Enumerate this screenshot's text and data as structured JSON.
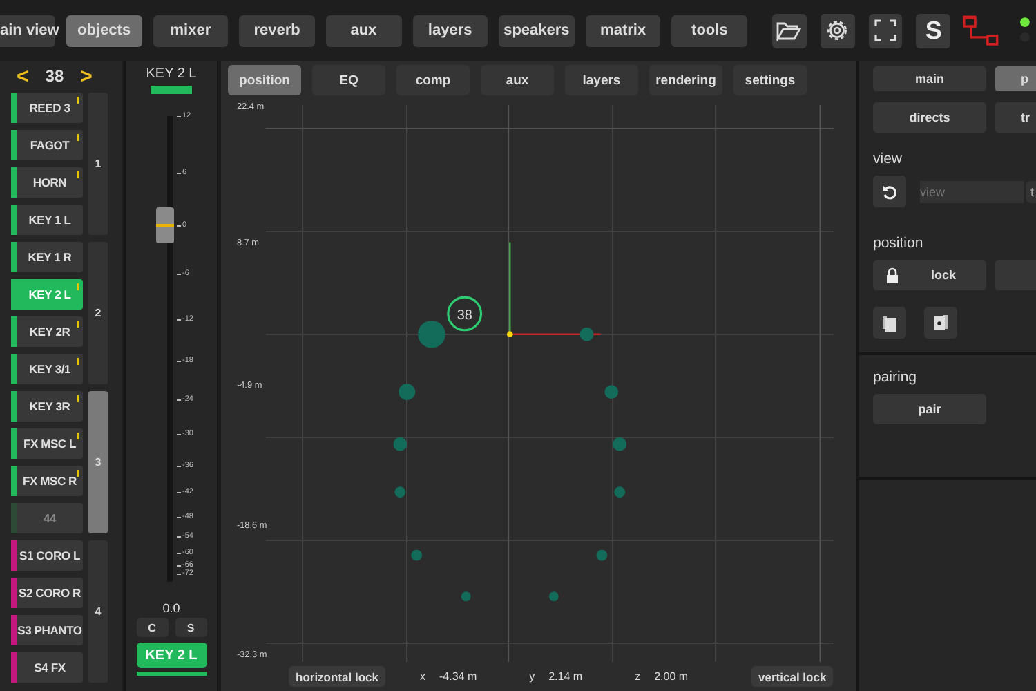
{
  "nav": {
    "items": [
      {
        "label": "ain view",
        "selected": false
      },
      {
        "label": "objects",
        "selected": true
      },
      {
        "label": "mixer",
        "selected": false
      },
      {
        "label": "reverb",
        "selected": false
      },
      {
        "label": "aux",
        "selected": false
      },
      {
        "label": "layers",
        "selected": false
      },
      {
        "label": "speakers",
        "selected": false
      },
      {
        "label": "matrix",
        "selected": false
      },
      {
        "label": "tools",
        "selected": false
      }
    ],
    "s_button": "S"
  },
  "objects": {
    "prev": "<",
    "current": "38",
    "next": ">",
    "groups": [
      {
        "label": "1",
        "selected": false,
        "items": [
          {
            "name": "REED 3",
            "color": "#22b95c",
            "selected": false,
            "enabled": true,
            "flag": true
          },
          {
            "name": "FAGOT",
            "color": "#22b95c",
            "selected": false,
            "enabled": true,
            "flag": true
          },
          {
            "name": "HORN",
            "color": "#22b95c",
            "selected": false,
            "enabled": true,
            "flag": true
          },
          {
            "name": "KEY 1 L",
            "color": "#22b95c",
            "selected": false,
            "enabled": true,
            "flag": false
          }
        ]
      },
      {
        "label": "2",
        "selected": false,
        "items": [
          {
            "name": "KEY 1 R",
            "color": "#22b95c",
            "selected": false,
            "enabled": true,
            "flag": false
          },
          {
            "name": "KEY 2 L",
            "color": "#22b95c",
            "selected": true,
            "enabled": true,
            "flag": true
          },
          {
            "name": "KEY 2R",
            "color": "#22b95c",
            "selected": false,
            "enabled": true,
            "flag": true
          },
          {
            "name": "KEY 3/1",
            "color": "#22b95c",
            "selected": false,
            "enabled": true,
            "flag": true
          }
        ]
      },
      {
        "label": "3",
        "selected": true,
        "items": [
          {
            "name": "KEY 3R",
            "color": "#22b95c",
            "selected": false,
            "enabled": true,
            "flag": true
          },
          {
            "name": "FX MSC L",
            "color": "#22b95c",
            "selected": false,
            "enabled": true,
            "flag": true
          },
          {
            "name": "FX MSC R",
            "color": "#22b95c",
            "selected": false,
            "enabled": true,
            "flag": true
          },
          {
            "name": "44",
            "color": "#2c4a36",
            "selected": false,
            "enabled": false,
            "flag": false
          }
        ]
      },
      {
        "label": "4",
        "selected": false,
        "items": [
          {
            "name": "S1 CORO L",
            "color": "#c4187e",
            "selected": false,
            "enabled": true,
            "flag": false
          },
          {
            "name": "S2 CORO R",
            "color": "#c4187e",
            "selected": false,
            "enabled": true,
            "flag": false
          },
          {
            "name": "S3 PHANTO",
            "color": "#c4187e",
            "selected": false,
            "enabled": true,
            "flag": false
          },
          {
            "name": "S4 FX",
            "color": "#c4187e",
            "selected": false,
            "enabled": true,
            "flag": false
          }
        ]
      }
    ]
  },
  "mixer": {
    "name": "KEY 2 L",
    "fader": {
      "level": 0.76
    },
    "scale": [
      "12",
      "6",
      "0",
      "-6",
      "-12",
      "-18",
      "-24",
      "-30",
      "-36",
      "-42",
      "-48",
      "-54",
      "-60",
      "-66",
      "-72"
    ],
    "readout": "0.0",
    "buttons": [
      "C",
      "S"
    ],
    "assign": "KEY 2 L"
  },
  "position": {
    "tabs": [
      {
        "label": "position",
        "selected": true
      },
      {
        "label": "EQ",
        "selected": false
      },
      {
        "label": "comp",
        "selected": false
      },
      {
        "label": "aux",
        "selected": false
      },
      {
        "label": "layers",
        "selected": false
      },
      {
        "label": "rendering",
        "selected": false
      },
      {
        "label": "settings",
        "selected": false
      }
    ],
    "y_labels": [
      "22.4 m",
      "8.7 m",
      "-4.9 m",
      "-18.6 m",
      "-32.3 m"
    ],
    "selected_object": "38",
    "horizontal_lock": "horizontal lock",
    "coords": [
      {
        "axis": "x",
        "value": "-4.34 m"
      },
      {
        "axis": "y",
        "value": "2.14 m"
      },
      {
        "axis": "z",
        "value": "2.00 m"
      }
    ],
    "vertical_lock": "vertical lock"
  },
  "side": {
    "tabs_row1": [
      {
        "label": "main",
        "selected": false
      },
      {
        "label": "p",
        "selected": true
      }
    ],
    "tabs_row2": [
      {
        "label": "directs",
        "selected": false
      },
      {
        "label": "tr",
        "selected": false
      }
    ],
    "sections": [
      {
        "kind": "view",
        "title": "view",
        "placeholder": "view",
        "next": "t"
      },
      {
        "kind": "position",
        "title": "position",
        "lock": "lock"
      },
      {
        "kind": "pairing",
        "title": "pairing",
        "button": "pair"
      }
    ]
  }
}
